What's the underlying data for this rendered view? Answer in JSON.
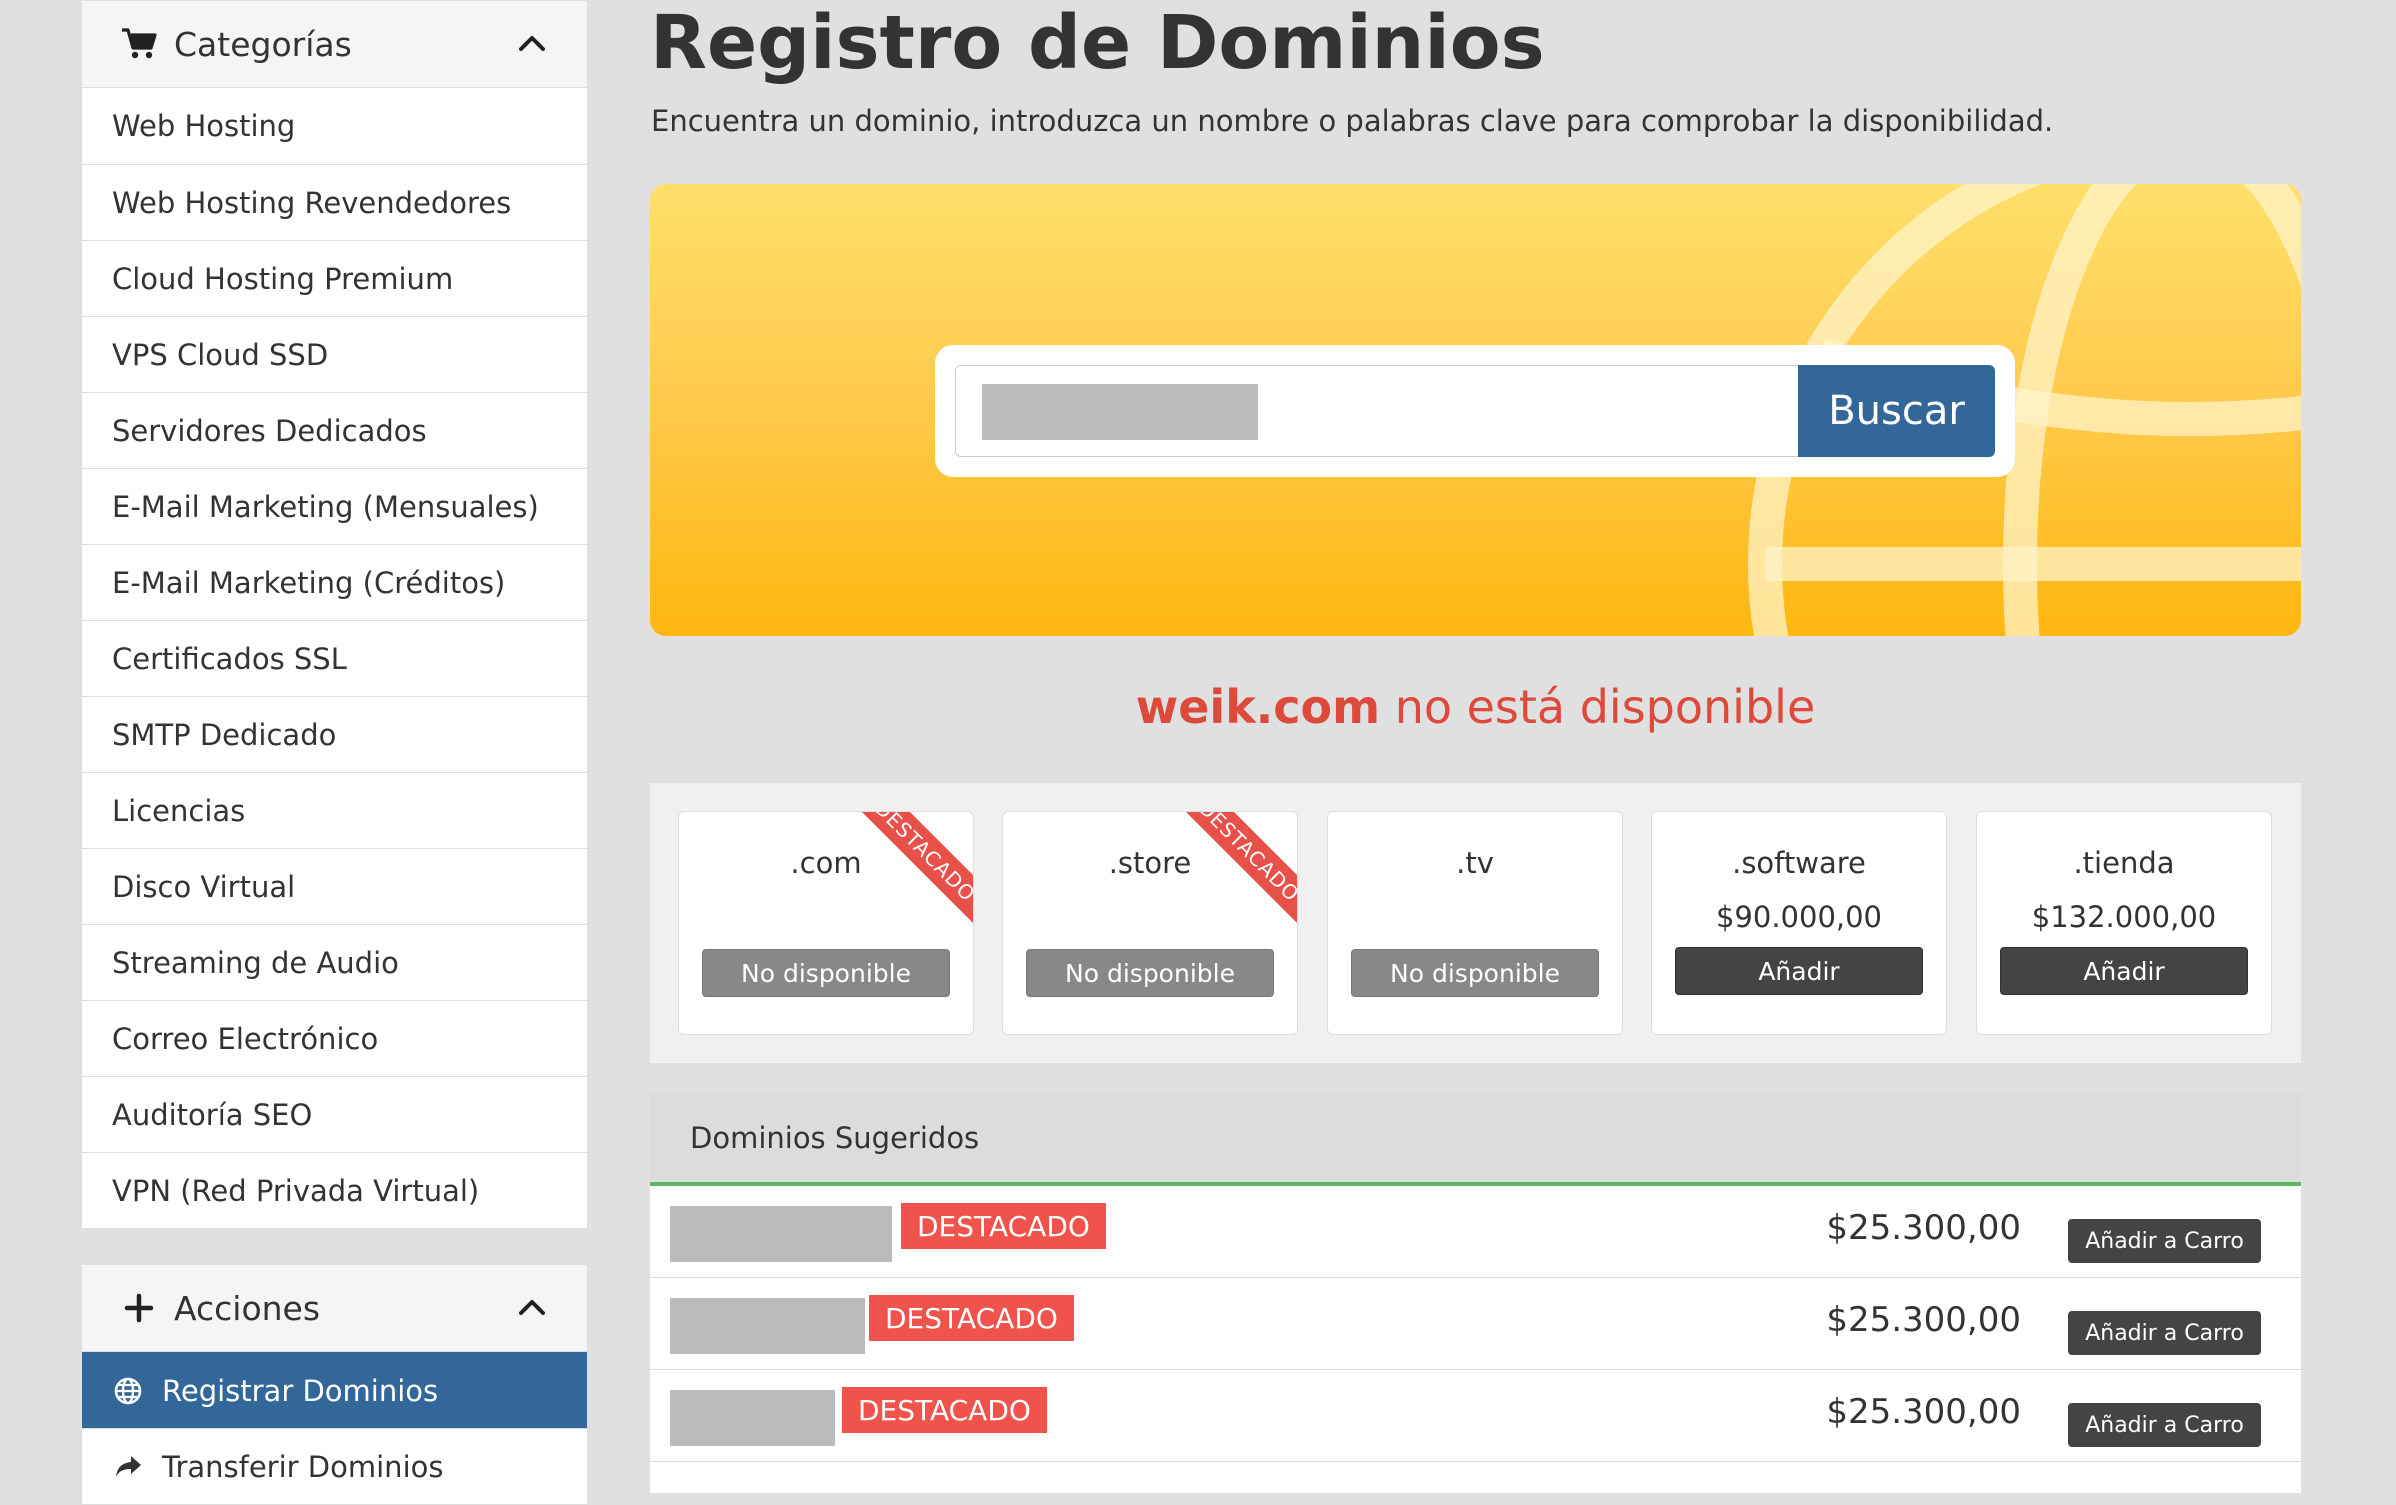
{
  "sidebar": {
    "categories": {
      "title": "Categorías",
      "items": [
        {
          "label": "Web Hosting"
        },
        {
          "label": "Web Hosting Revendedores"
        },
        {
          "label": "Cloud Hosting Premium"
        },
        {
          "label": "VPS Cloud SSD"
        },
        {
          "label": "Servidores Dedicados"
        },
        {
          "label": "E-Mail Marketing (Mensuales)"
        },
        {
          "label": "E-Mail Marketing (Créditos)"
        },
        {
          "label": "Certificados SSL"
        },
        {
          "label": "SMTP Dedicado"
        },
        {
          "label": "Licencias"
        },
        {
          "label": "Disco Virtual"
        },
        {
          "label": "Streaming de Audio"
        },
        {
          "label": "Correo Electrónico"
        },
        {
          "label": "Auditoría SEO"
        },
        {
          "label": "VPN (Red Privada Virtual)"
        }
      ]
    },
    "actions": {
      "title": "Acciones",
      "items": [
        {
          "label": "Registrar Dominios",
          "icon": "globe-icon",
          "active": true
        },
        {
          "label": "Transferir Dominios",
          "icon": "share-arrow-icon",
          "active": false
        }
      ]
    }
  },
  "main": {
    "title": "Registro de Dominios",
    "subtitle": "Encuentra un dominio, introduzca un nombre o palabras clave para comprobar la disponibilidad.",
    "search": {
      "value": "",
      "button_label": "Buscar"
    },
    "status": {
      "domain": "weik.com",
      "message": "no está disponible"
    },
    "tlds": [
      {
        "name": ".com",
        "price": "",
        "button": "No disponible",
        "available": false,
        "ribbon": "DESTACADO"
      },
      {
        "name": ".store",
        "price": "",
        "button": "No disponible",
        "available": false,
        "ribbon": "DESTACADO"
      },
      {
        "name": ".tv",
        "price": "",
        "button": "No disponible",
        "available": false,
        "ribbon": ""
      },
      {
        "name": ".software",
        "price": "$90.000,00",
        "button": "Añadir",
        "available": true,
        "ribbon": ""
      },
      {
        "name": ".tienda",
        "price": "$132.000,00",
        "button": "Añadir",
        "available": true,
        "ribbon": ""
      }
    ],
    "suggested": {
      "title": "Dominios Sugeridos",
      "rows": [
        {
          "badge": "DESTACADO",
          "price": "$25.300,00",
          "button": "Añadir a Carro"
        },
        {
          "badge": "DESTACADO",
          "price": "$25.300,00",
          "button": "Añadir a Carro"
        },
        {
          "badge": "DESTACADO",
          "price": "$25.300,00",
          "button": "Añadir a Carro"
        }
      ]
    }
  },
  "colors": {
    "primary": "#336699",
    "danger": "#dd4a3c",
    "badge": "#f0524c",
    "hero_top": "#ffdf6b",
    "hero_bottom": "#ffb70f",
    "success_line": "#5cb85c"
  }
}
